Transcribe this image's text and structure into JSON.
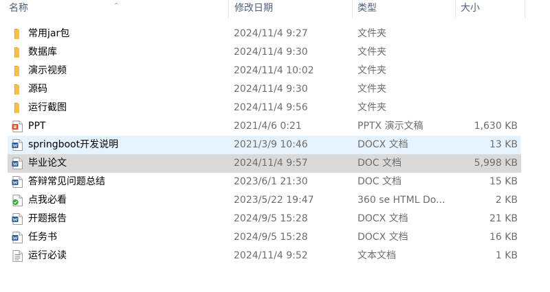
{
  "columns": {
    "name": "名称",
    "date": "修改日期",
    "type": "类型",
    "size": "大小",
    "sort_indicator": "^"
  },
  "colors": {
    "folder": "#f5c242",
    "folder_dark": "#e0a82e",
    "ppt": "#d35230",
    "word": "#2b5797",
    "html_green": "#3aa64a",
    "hover_bg": "#e5f3ff",
    "selected_bg": "#d9d9d9"
  },
  "files": [
    {
      "name": "常用jar包",
      "date": "2024/11/4 9:27",
      "type": "文件夹",
      "size": "",
      "icon": "folder-icon"
    },
    {
      "name": "数据库",
      "date": "2024/11/4 9:30",
      "type": "文件夹",
      "size": "",
      "icon": "folder-icon"
    },
    {
      "name": "演示视频",
      "date": "2024/11/4 10:02",
      "type": "文件夹",
      "size": "",
      "icon": "folder-icon"
    },
    {
      "name": "源码",
      "date": "2024/11/4 9:30",
      "type": "文件夹",
      "size": "",
      "icon": "folder-icon"
    },
    {
      "name": "运行截图",
      "date": "2024/11/4 9:56",
      "type": "文件夹",
      "size": "",
      "icon": "folder-icon"
    },
    {
      "name": "PPT",
      "date": "2021/4/6 0:21",
      "type": "PPTX 演示文稿",
      "size": "1,630 KB",
      "icon": "powerpoint-file-icon"
    },
    {
      "name": "springboot开发说明",
      "date": "2021/3/9 10:46",
      "type": "DOCX 文档",
      "size": "13 KB",
      "icon": "word-file-icon",
      "state": "hover"
    },
    {
      "name": "毕业论文",
      "date": "2024/11/4 9:57",
      "type": "DOC 文档",
      "size": "5,998 KB",
      "icon": "word-file-icon",
      "state": "selected"
    },
    {
      "name": "答辩常见问题总结",
      "date": "2023/6/1 21:30",
      "type": "DOC 文档",
      "size": "15 KB",
      "icon": "word-file-icon"
    },
    {
      "name": "点我必看",
      "date": "2023/5/22 19:47",
      "type": "360 se HTML Do...",
      "size": "2 KB",
      "icon": "html-file-icon"
    },
    {
      "name": "开题报告",
      "date": "2024/9/5 15:28",
      "type": "DOCX 文档",
      "size": "21 KB",
      "icon": "word-file-icon"
    },
    {
      "name": "任务书",
      "date": "2024/9/5 15:28",
      "type": "DOCX 文档",
      "size": "16 KB",
      "icon": "word-file-icon"
    },
    {
      "name": "运行必读",
      "date": "2024/11/4 9:52",
      "type": "文本文档",
      "size": "1 KB",
      "icon": "text-file-icon"
    }
  ]
}
